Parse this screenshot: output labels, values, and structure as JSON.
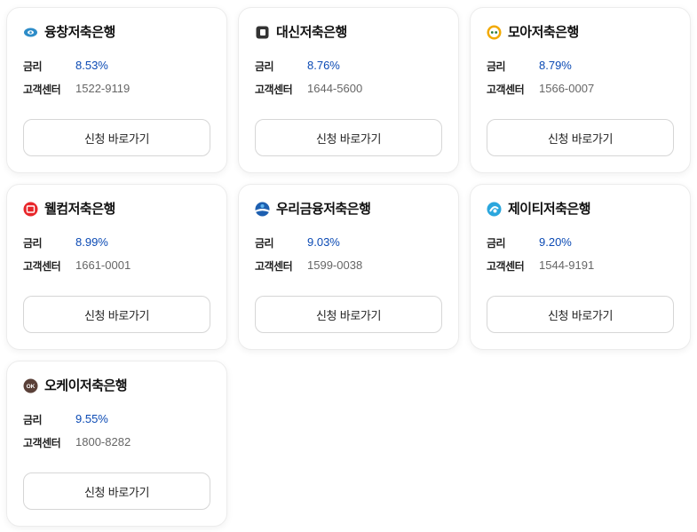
{
  "labels": {
    "rate": "금리",
    "phone": "고객센터",
    "apply": "신청 바로가기"
  },
  "banks": [
    {
      "name": "융창저축은행",
      "rate": "8.53%",
      "phone": "1522-9119",
      "logo_color": "#2d8cc8"
    },
    {
      "name": "대신저축은행",
      "rate": "8.76%",
      "phone": "1644-5600",
      "logo_color": "#333333"
    },
    {
      "name": "모아저축은행",
      "rate": "8.79%",
      "phone": "1566-0007",
      "logo_color": "#f2a900"
    },
    {
      "name": "웰컴저축은행",
      "rate": "8.99%",
      "phone": "1661-0001",
      "logo_color": "#e8262a"
    },
    {
      "name": "우리금융저축은행",
      "rate": "9.03%",
      "phone": "1599-0038",
      "logo_color": "#1d5fb0"
    },
    {
      "name": "제이티저축은행",
      "rate": "9.20%",
      "phone": "1544-9191",
      "logo_color": "#2aa6dd"
    },
    {
      "name": "오케이저축은행",
      "rate": "9.55%",
      "phone": "1800-8282",
      "logo_color": "#5a4038"
    }
  ]
}
